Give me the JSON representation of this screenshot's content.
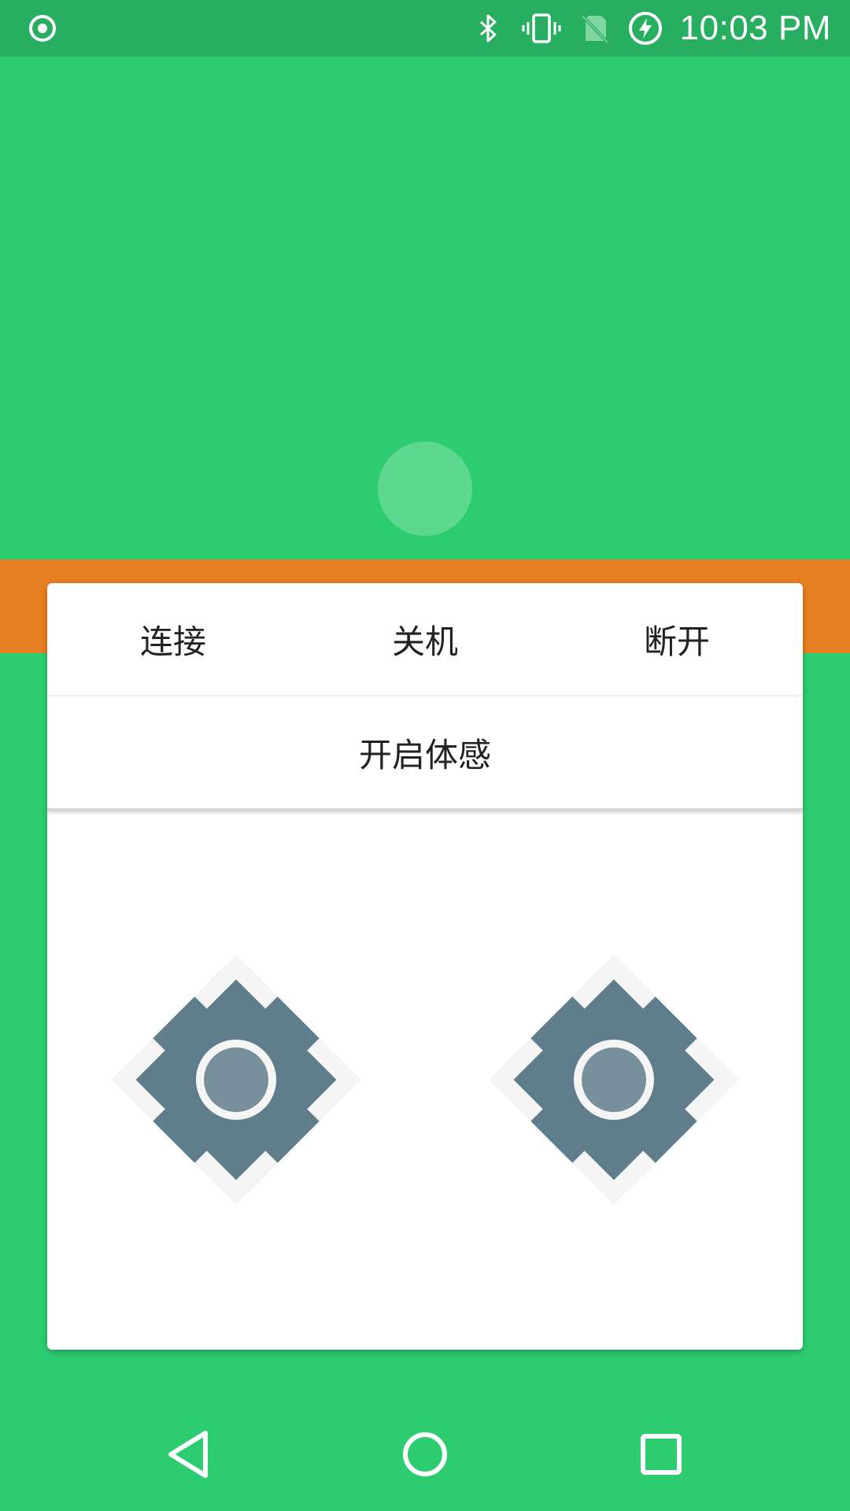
{
  "status_bar": {
    "time": "10:03 PM",
    "icons": [
      "record-icon",
      "bluetooth-icon",
      "vibrate-icon",
      "no-sim-icon",
      "battery-charging-icon"
    ]
  },
  "controls": {
    "connect": "连接",
    "shutdown": "关机",
    "disconnect": "断开",
    "motion_sensing": "开启体感"
  },
  "dpads": [
    {
      "name": "left-dpad",
      "icons": [
        "arrow-up-icon",
        "arrow-down-icon",
        "arrow-left-icon",
        "arrow-right-icon",
        "center-button-icon"
      ]
    },
    {
      "name": "right-dpad",
      "icons": [
        "arrow-up-icon",
        "arrow-down-icon",
        "arrow-left-icon",
        "arrow-right-icon",
        "center-button-icon"
      ]
    }
  ],
  "nav_bar": {
    "icons": [
      "back-icon",
      "home-icon",
      "recent-apps-icon"
    ]
  },
  "colors": {
    "background": "#2ecc71",
    "status_bar": "#27ae60",
    "orange_band": "#e67e22",
    "dpad": "#607d8b",
    "dpad_center": "#78909c",
    "card": "#ffffff"
  }
}
